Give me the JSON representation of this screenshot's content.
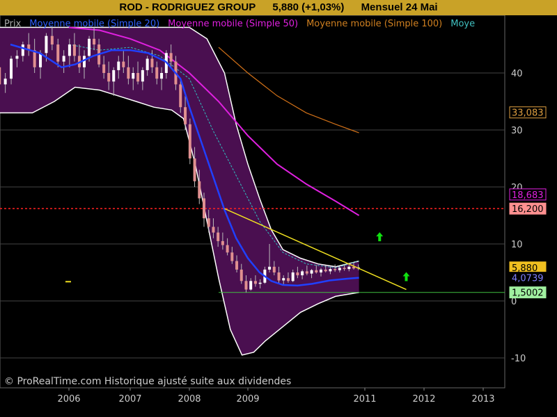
{
  "header": {
    "ticker": "ROD - RODRIGUEZ GROUP",
    "price_change": "5,880 (+1,03%)",
    "period": "Mensuel  24 Mai"
  },
  "legend": [
    {
      "label": "Prix",
      "color": "#aaaaaa"
    },
    {
      "label": "Moyenne mobile (Simple 20)",
      "color": "#3060ff"
    },
    {
      "label": "Moyenne mobile (Simple 50)",
      "color": "#e020e0"
    },
    {
      "label": "Moyenne mobile (Simple 100)",
      "color": "#d08020"
    },
    {
      "label": "Moye",
      "color": "#40c0c0"
    }
  ],
  "footer": "© ProRealTime.com Historique ajusté suite aux dividendes",
  "colors": {
    "band_fill": "#4a0f50",
    "band_edge": "#ffffff",
    "ma20": "#2040ff",
    "ma50": "#e020e0",
    "ma100": "#d07018",
    "ma_dash": "#30c0c0",
    "trendline": "#f0e020",
    "resistance": "#ff2020",
    "support": "#40c040",
    "arrow": "#10e010",
    "candle_up": "#ffffff",
    "candle_down": "#e09090"
  },
  "chart_data": {
    "type": "candlestick",
    "x_ticks": [
      "2006",
      "2007",
      "2008",
      "2009",
      "2011",
      "2012",
      "2013"
    ],
    "y_ticks": [
      -10,
      0,
      10,
      20,
      30,
      40
    ],
    "ylim": [
      -14,
      48
    ],
    "price_labels": [
      {
        "text": "33,083",
        "value": 33.083,
        "bg": "#000000",
        "fg": "#e0a040",
        "border": "#e0a040"
      },
      {
        "text": "18,683",
        "value": 18.683,
        "bg": "#000000",
        "fg": "#e020e0",
        "border": "#e020e0"
      },
      {
        "text": "16,200",
        "value": 16.2,
        "bg": "#ff9090",
        "fg": "#000000",
        "border": "#ff9090"
      },
      {
        "text": "5,880",
        "value": 5.88,
        "bg": "#f0c020",
        "fg": "#000000",
        "border": "#f0c020"
      },
      {
        "text": "4,0739",
        "value": 4.07,
        "bg": "#000000",
        "fg": "#8080ff",
        "border": "#000000"
      },
      {
        "text": "1,5002",
        "value": 1.5,
        "bg": "#a0f0a0",
        "fg": "#000000",
        "border": "#a0f0a0"
      }
    ],
    "horizontal_levels": [
      {
        "name": "resistance",
        "value": 16.2
      },
      {
        "name": "support",
        "value": 1.5
      }
    ],
    "ma20": [
      [
        2005.2,
        45
      ],
      [
        2005.6,
        43.5
      ],
      [
        2005.9,
        41
      ],
      [
        2006.1,
        41.5
      ],
      [
        2006.4,
        43
      ],
      [
        2006.7,
        44
      ],
      [
        2007.0,
        44
      ],
      [
        2007.3,
        43.5
      ],
      [
        2007.6,
        42
      ],
      [
        2007.85,
        39
      ],
      [
        2008.0,
        34
      ],
      [
        2008.2,
        28
      ],
      [
        2008.4,
        22
      ],
      [
        2008.6,
        16
      ],
      [
        2008.8,
        11
      ],
      [
        2009.0,
        7.5
      ],
      [
        2009.2,
        5
      ],
      [
        2009.4,
        3.5
      ],
      [
        2009.6,
        2.8
      ],
      [
        2009.85,
        2.7
      ],
      [
        2010.1,
        3
      ],
      [
        2010.4,
        3.6
      ],
      [
        2010.7,
        3.9
      ],
      [
        2010.9,
        4.07
      ]
    ],
    "ma50": [
      [
        2006.0,
        48
      ],
      [
        2006.5,
        47.5
      ],
      [
        2007.0,
        46
      ],
      [
        2007.5,
        44
      ],
      [
        2008.0,
        40
      ],
      [
        2008.5,
        35
      ],
      [
        2009.0,
        29
      ],
      [
        2009.5,
        24
      ],
      [
        2010.0,
        20.5
      ],
      [
        2010.5,
        17.5
      ],
      [
        2010.9,
        15
      ]
    ],
    "ma100": [
      [
        2008.5,
        44.5
      ],
      [
        2009.0,
        40
      ],
      [
        2009.5,
        36
      ],
      [
        2010.0,
        33
      ],
      [
        2010.5,
        31
      ],
      [
        2010.9,
        29.5
      ]
    ],
    "ma_dash": [
      [
        2006.0,
        45
      ],
      [
        2006.5,
        44
      ],
      [
        2007.0,
        44.5
      ],
      [
        2007.5,
        43
      ],
      [
        2008.0,
        39
      ],
      [
        2008.4,
        30
      ],
      [
        2008.8,
        22
      ],
      [
        2009.2,
        14
      ],
      [
        2009.6,
        8.5
      ],
      [
        2010.0,
        6.5
      ],
      [
        2010.5,
        5.8
      ],
      [
        2010.9,
        7
      ]
    ],
    "band_upper": [
      [
        2005.0,
        48
      ],
      [
        2006.0,
        48
      ],
      [
        2007.0,
        48
      ],
      [
        2007.5,
        48
      ],
      [
        2008.0,
        48
      ],
      [
        2008.3,
        46
      ],
      [
        2008.6,
        40
      ],
      [
        2008.8,
        31
      ],
      [
        2009.0,
        24
      ],
      [
        2009.2,
        18
      ],
      [
        2009.4,
        12.5
      ],
      [
        2009.6,
        9
      ],
      [
        2009.9,
        7.5
      ],
      [
        2010.2,
        6.5
      ],
      [
        2010.5,
        6
      ],
      [
        2010.9,
        7
      ]
    ],
    "band_lower": [
      [
        2005.0,
        33
      ],
      [
        2005.5,
        33
      ],
      [
        2005.8,
        35
      ],
      [
        2006.1,
        37.5
      ],
      [
        2006.5,
        37
      ],
      [
        2006.8,
        36
      ],
      [
        2007.1,
        35
      ],
      [
        2007.4,
        34
      ],
      [
        2007.7,
        33.5
      ],
      [
        2007.9,
        32
      ],
      [
        2008.1,
        24
      ],
      [
        2008.3,
        14
      ],
      [
        2008.5,
        4
      ],
      [
        2008.7,
        -5
      ],
      [
        2008.9,
        -9.5
      ],
      [
        2009.1,
        -9
      ],
      [
        2009.3,
        -7
      ],
      [
        2009.6,
        -4.5
      ],
      [
        2009.9,
        -2
      ],
      [
        2010.2,
        -0.5
      ],
      [
        2010.5,
        0.8
      ],
      [
        2010.9,
        1.5
      ]
    ],
    "trendline": {
      "from": [
        2008.6,
        16.2
      ],
      "to": [
        2011.7,
        2
      ]
    },
    "arrows": [
      [
        2011.25,
        11.2
      ],
      [
        2011.7,
        4.2
      ]
    ],
    "candles": [
      [
        2005.05,
        41,
        42.5,
        37,
        38
      ],
      [
        2005.13,
        38,
        40,
        36.5,
        39
      ],
      [
        2005.21,
        39,
        43,
        38,
        42.5
      ],
      [
        2005.29,
        42.5,
        44,
        41,
        43
      ],
      [
        2005.37,
        43,
        45.5,
        42,
        45
      ],
      [
        2005.45,
        45,
        47,
        43,
        44
      ],
      [
        2005.53,
        44,
        46,
        40,
        41
      ],
      [
        2005.61,
        41,
        44,
        39,
        43.5
      ],
      [
        2005.69,
        43.5,
        47,
        42,
        46.5
      ],
      [
        2005.77,
        46.5,
        48,
        44,
        45
      ],
      [
        2005.85,
        45,
        46,
        41,
        42
      ],
      [
        2005.93,
        42,
        44,
        40,
        43
      ],
      [
        2006.01,
        43,
        46,
        41,
        45
      ],
      [
        2006.09,
        45,
        47,
        42,
        43
      ],
      [
        2006.17,
        43,
        45,
        40,
        41
      ],
      [
        2006.25,
        41,
        44,
        39,
        43
      ],
      [
        2006.33,
        43,
        46.5,
        42,
        46
      ],
      [
        2006.41,
        46,
        48,
        44,
        45
      ],
      [
        2006.49,
        45,
        46,
        41,
        41.5
      ],
      [
        2006.57,
        41.5,
        43,
        39,
        40
      ],
      [
        2006.65,
        40,
        42,
        37,
        38.5
      ],
      [
        2006.73,
        38.5,
        41,
        36,
        40.5
      ],
      [
        2006.81,
        40.5,
        43,
        39,
        42
      ],
      [
        2006.89,
        42,
        44,
        40,
        41
      ],
      [
        2006.97,
        41,
        43,
        38,
        39
      ],
      [
        2007.05,
        39,
        41,
        37,
        40
      ],
      [
        2007.13,
        40,
        42,
        38,
        38.5
      ],
      [
        2007.21,
        38.5,
        41,
        37,
        40.5
      ],
      [
        2007.29,
        40.5,
        43,
        39.5,
        42.5
      ],
      [
        2007.37,
        42.5,
        44,
        40,
        41
      ],
      [
        2007.45,
        41,
        42,
        38,
        39
      ],
      [
        2007.53,
        39,
        41,
        37,
        40
      ],
      [
        2007.61,
        40,
        44,
        39,
        43.5
      ],
      [
        2007.69,
        43.5,
        45,
        41,
        42
      ],
      [
        2007.77,
        42,
        43,
        37,
        38
      ],
      [
        2007.85,
        38,
        39,
        33,
        34
      ],
      [
        2007.93,
        34,
        36,
        30,
        31
      ],
      [
        2008.01,
        31,
        32,
        24,
        25
      ],
      [
        2008.09,
        25,
        27,
        20,
        21
      ],
      [
        2008.17,
        21,
        23,
        17,
        18
      ],
      [
        2008.25,
        18,
        19,
        13,
        14.5
      ],
      [
        2008.33,
        14.5,
        16,
        12,
        13
      ],
      [
        2008.41,
        13,
        14.5,
        11,
        12
      ],
      [
        2008.49,
        12,
        13,
        9.5,
        10.5
      ],
      [
        2008.57,
        10.5,
        12,
        9,
        9.8
      ],
      [
        2008.65,
        9.8,
        11,
        8,
        8.5
      ],
      [
        2008.73,
        8.5,
        9.5,
        6.5,
        7
      ],
      [
        2008.81,
        7,
        8,
        5,
        5.5
      ],
      [
        2008.89,
        5.5,
        6.5,
        3,
        3.5
      ],
      [
        2008.97,
        3.5,
        4.5,
        1.5,
        2
      ],
      [
        2009.05,
        2,
        4,
        1.8,
        3.5
      ],
      [
        2009.13,
        3.5,
        4.5,
        2.5,
        3
      ],
      [
        2009.21,
        3,
        3.8,
        2.2,
        3.2
      ],
      [
        2009.29,
        3.2,
        6,
        3,
        5.5
      ],
      [
        2009.37,
        5.5,
        10,
        5,
        6
      ],
      [
        2009.45,
        6,
        7,
        4.5,
        5
      ],
      [
        2009.53,
        5,
        6,
        3,
        3.6
      ],
      [
        2009.61,
        3.6,
        4.5,
        2.8,
        4
      ],
      [
        2009.69,
        4,
        5,
        3.2,
        3.5
      ],
      [
        2009.77,
        3.5,
        5.5,
        3.3,
        5
      ],
      [
        2009.85,
        5,
        6,
        4,
        4.5
      ],
      [
        2009.93,
        4.5,
        5.5,
        3.8,
        5.2
      ],
      [
        2010.01,
        5.2,
        6.2,
        4.5,
        4.8
      ],
      [
        2010.09,
        4.8,
        5.6,
        4,
        5.4
      ],
      [
        2010.17,
        5.4,
        6.3,
        4.8,
        5
      ],
      [
        2010.25,
        5,
        5.8,
        4.3,
        5.5
      ],
      [
        2010.33,
        5.5,
        6.2,
        5,
        5.2
      ],
      [
        2010.41,
        5.2,
        6,
        4.7,
        5.6
      ],
      [
        2010.49,
        5.6,
        6.4,
        5.1,
        5.4
      ],
      [
        2010.57,
        5.4,
        6.1,
        5,
        5.8
      ],
      [
        2010.65,
        5.8,
        6.5,
        5.3,
        5.6
      ],
      [
        2010.73,
        5.6,
        6.3,
        5.2,
        6
      ],
      [
        2010.81,
        6,
        6.8,
        5.5,
        5.7
      ],
      [
        2010.89,
        5.7,
        6.4,
        5.4,
        5.88
      ]
    ],
    "year_map": [
      [
        2005.0,
        -6
      ],
      [
        2006.0,
        99
      ],
      [
        2007.0,
        187
      ],
      [
        2008.0,
        272
      ],
      [
        2009.0,
        356
      ],
      [
        2010.0,
        440
      ],
      [
        2011.0,
        524
      ],
      [
        2012.0,
        609
      ],
      [
        2013.0,
        694
      ]
    ]
  }
}
